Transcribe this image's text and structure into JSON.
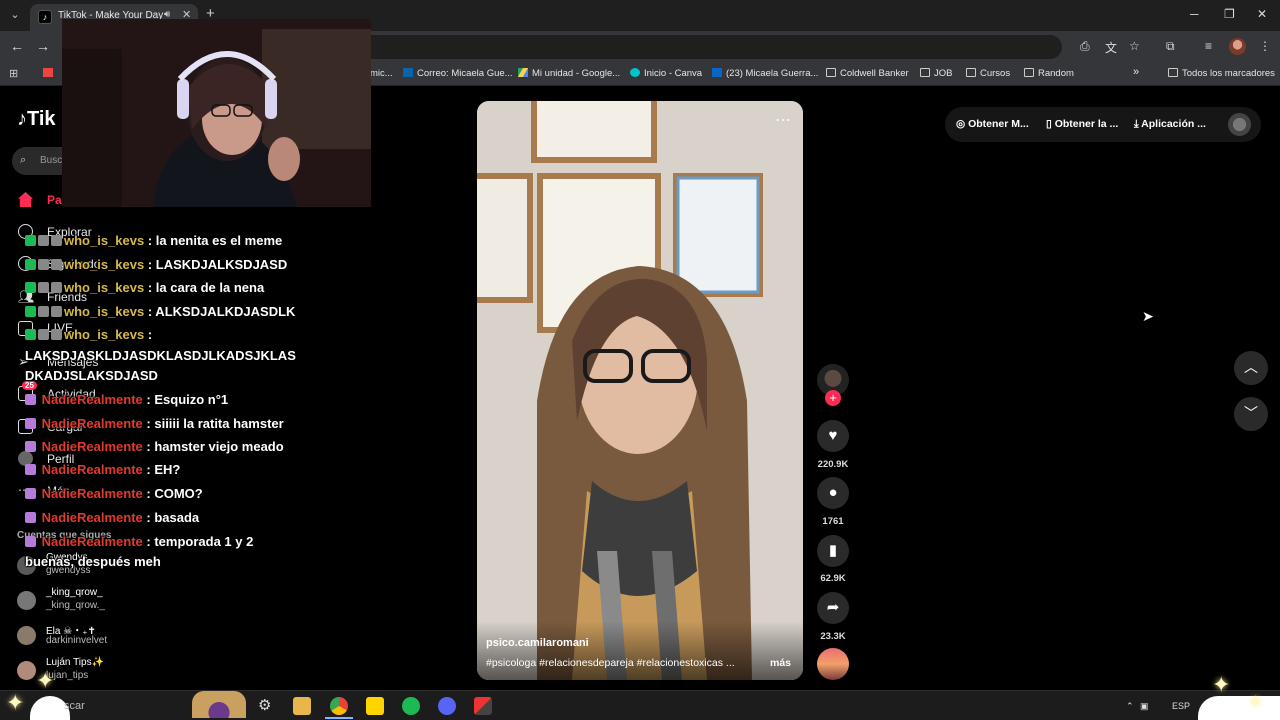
{
  "browser": {
    "tab_title": "TikTok - Make Your Day",
    "tab_favicon": "tiktok-icon",
    "icons": {
      "tab_menu": "chevron-down-icon",
      "audio": "speaker-icon",
      "close": "close-icon",
      "new_tab": "plus-icon",
      "back": "arrow-left-icon",
      "forward": "arrow-right-icon"
    },
    "window_controls": {
      "minimize": "─",
      "restore": "❐",
      "close": "✕"
    },
    "bookmarks": [
      {
        "label": "mic...",
        "icon": "bookmark-icon"
      },
      {
        "label": "Correo: Micaela Gue...",
        "icon": "outlook-icon"
      },
      {
        "label": "Mi unidad - Google...",
        "icon": "google-drive-icon"
      },
      {
        "label": "Inicio - Canva",
        "icon": "canva-icon"
      },
      {
        "label": "(23) Micaela Guerra...",
        "icon": "linkedin-icon"
      },
      {
        "label": "Coldwell Banker",
        "icon": "folder-icon"
      },
      {
        "label": "JOB",
        "icon": "folder-icon"
      },
      {
        "label": "Cursos",
        "icon": "folder-icon"
      },
      {
        "label": "Random",
        "icon": "folder-icon"
      }
    ],
    "bookmarks_overflow": "»",
    "all_bookmarks": "Todos los marcadores"
  },
  "tiktok": {
    "logo_partial": "Tik",
    "search_placeholder": "Busc",
    "nav": [
      {
        "label": "Pa",
        "icon": "home-icon"
      },
      {
        "label": "Explorar",
        "icon": "compass-icon"
      },
      {
        "label": "Siguiendo",
        "icon": "following-icon"
      },
      {
        "label": "Friends",
        "icon": "friends-icon"
      },
      {
        "label": "LIVE",
        "icon": "live-icon"
      },
      {
        "label": "Mensajes",
        "icon": "send-icon"
      },
      {
        "label": "Actividad",
        "icon": "inbox-icon"
      },
      {
        "label": "Cargar",
        "icon": "upload-icon"
      },
      {
        "label": "Perfil",
        "icon": "avatar-icon"
      },
      {
        "label": "Más",
        "icon": "more-icon"
      }
    ],
    "activity_badge": "25",
    "following_header": "Cuentas que sigues",
    "following": [
      {
        "name": "Gwendys",
        "handle": "gwendyss"
      },
      {
        "name": "_king_qrow_",
        "handle": "_king_qrow._"
      },
      {
        "name": "Ela ☠︎・₊✝",
        "handle": "darkininvelvet"
      },
      {
        "name": "Luján Tips✨",
        "handle": "lujan_tips"
      }
    ],
    "header_buttons": [
      "Obtener M...",
      "Obtener la ...",
      "Aplicación ..."
    ],
    "video": {
      "author": "psico.camilaromani",
      "tags": "#psicologa  #relacionesdepareja  #relacionestoxicas  ...",
      "more_label": "más",
      "menu": "⋯"
    },
    "actions": {
      "likes": "220.9K",
      "comments": "1761",
      "saves": "62.9K",
      "shares": "23.3K"
    }
  },
  "chat": [
    {
      "user": "who_is_kevs",
      "text": ": la nenita es el meme"
    },
    {
      "user": "who_is_kevs",
      "text": ": LASKDJALKSDJASD"
    },
    {
      "user": "who_is_kevs",
      "text": ": la cara de la nena"
    },
    {
      "user": "who_is_kevs",
      "text": ": ALKSDJALKDJASDLK"
    },
    {
      "user": "who_is_kevs",
      "text": ":"
    },
    {
      "user": "",
      "text": "LAKSDJASKLDJASDKLASDJLKADSJKLAS"
    },
    {
      "user": "",
      "text": "DKADJSLAKSDJASD"
    },
    {
      "user": "NadieRealmente",
      "text": ": Esquizo n°1"
    },
    {
      "user": "NadieRealmente",
      "text": ": siiiii la ratita hamster"
    },
    {
      "user": "NadieRealmente",
      "text": ": hamster viejo meado"
    },
    {
      "user": "NadieRealmente",
      "text": ": EH?"
    },
    {
      "user": "NadieRealmente",
      "text": ": COMO?"
    },
    {
      "user": "NadieRealmente",
      "text": ": basada"
    },
    {
      "user": "NadieRealmente",
      "text": ": temporada 1 y 2"
    },
    {
      "user": "",
      "text": "buenas, después meh"
    }
  ],
  "taskbar": {
    "search_placeholder": "scar",
    "language": "ESP"
  },
  "colors": {
    "tiktok_red": "#fe2c55",
    "chat_user_kevs": "#d6b84a",
    "chat_user_nadie": "#e03b2e"
  }
}
